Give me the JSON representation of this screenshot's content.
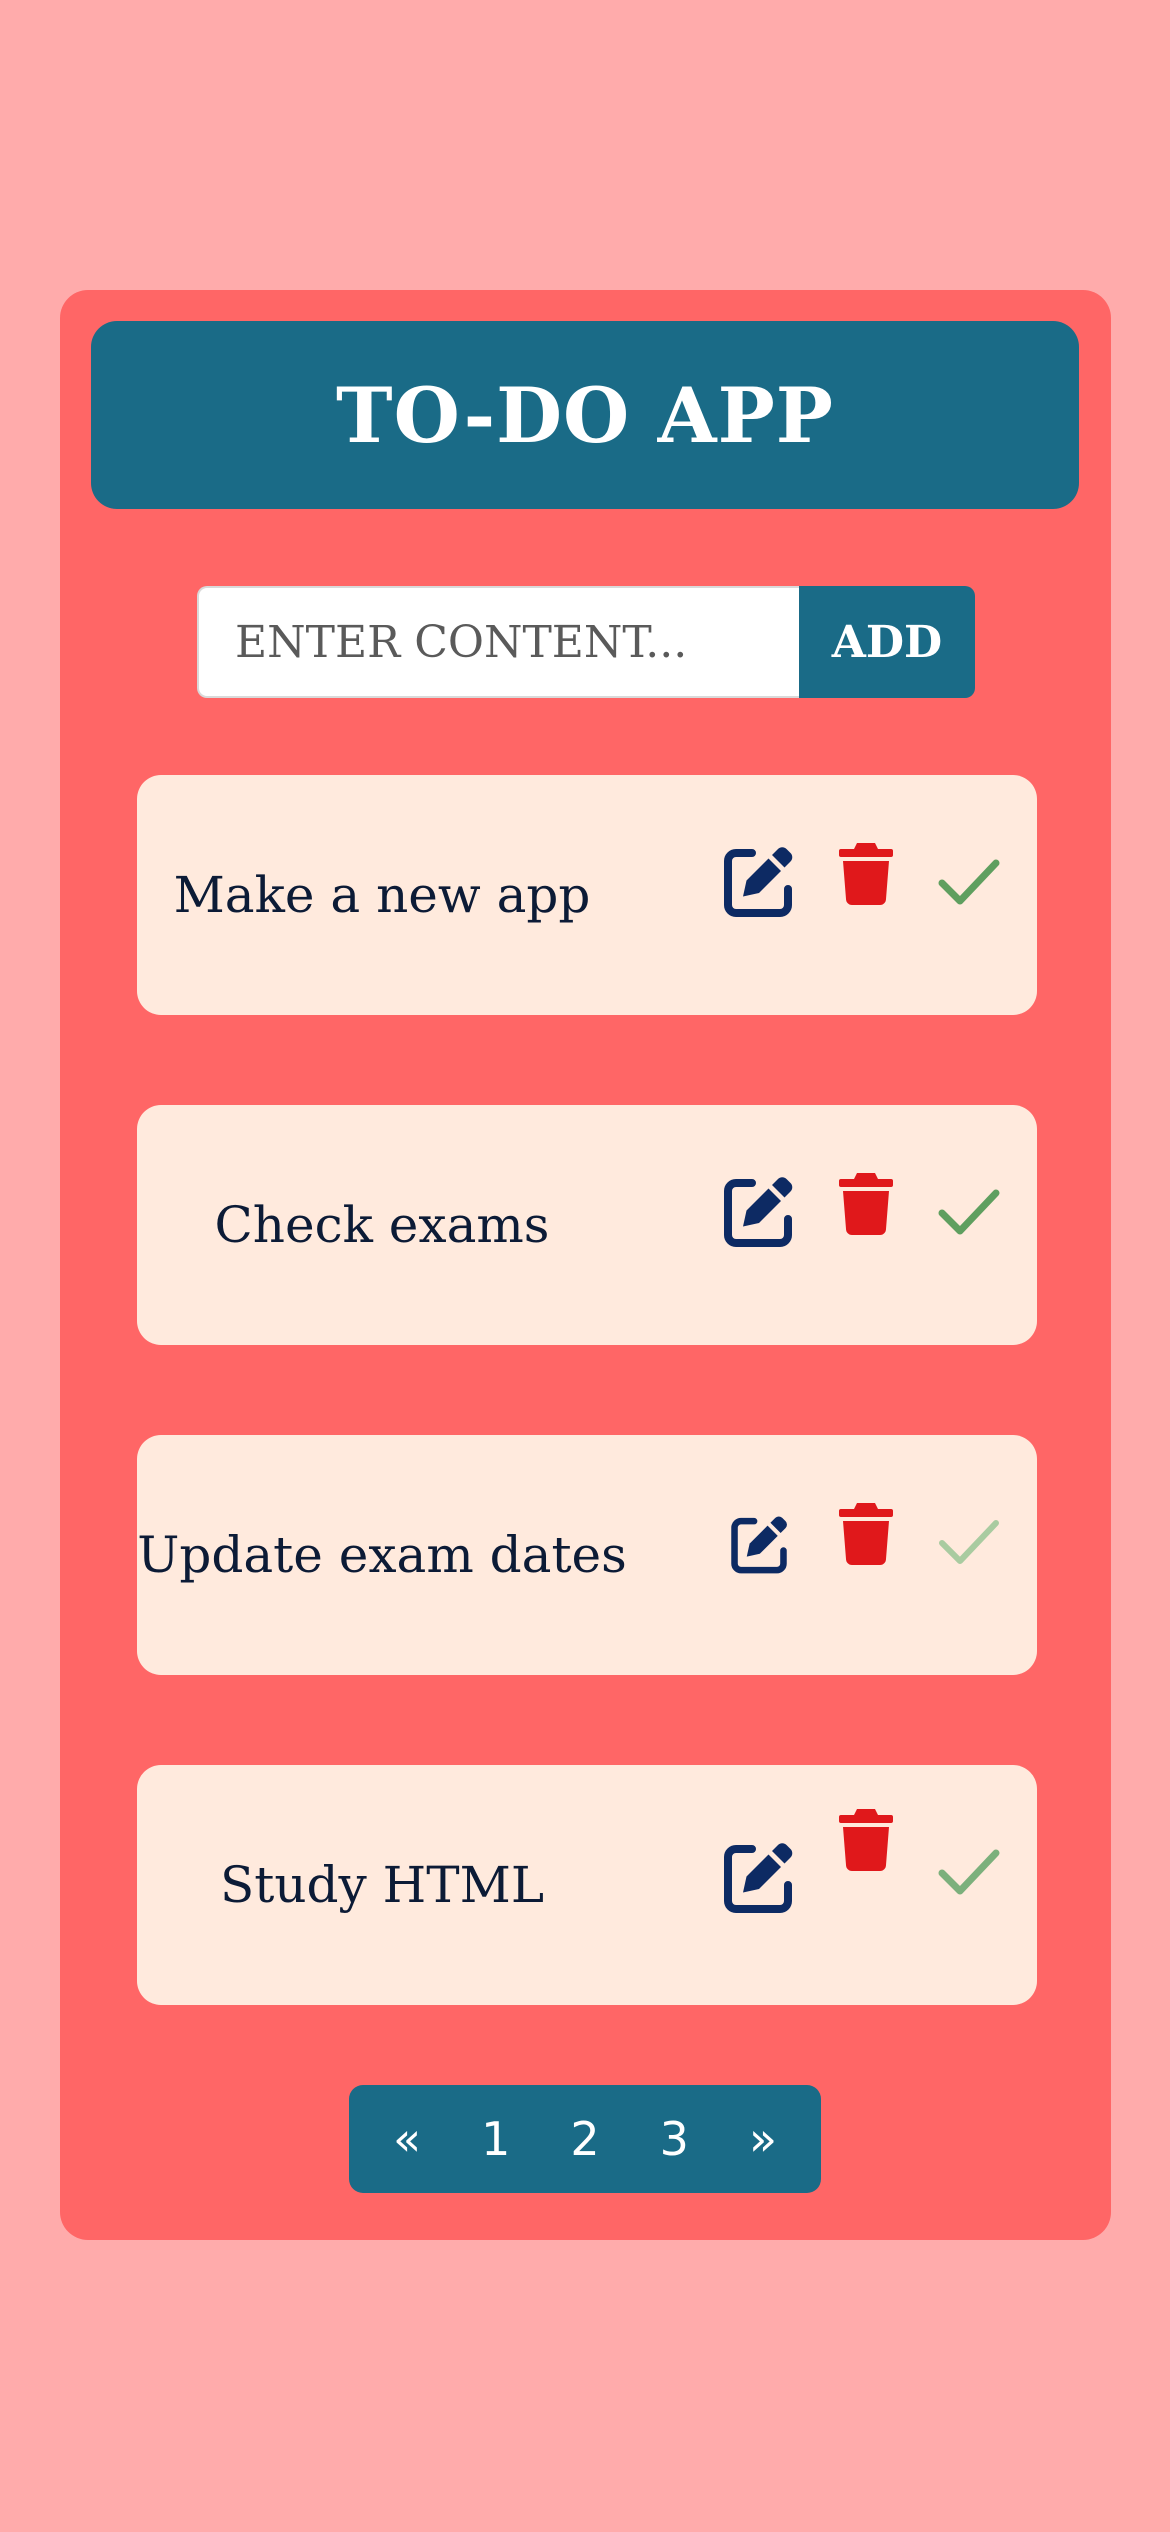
{
  "app": {
    "title": "TO-DO APP"
  },
  "input": {
    "placeholder": "ENTER CONTENT...",
    "value": "",
    "add_label": "ADD"
  },
  "todos": [
    {
      "text": "Make a new app",
      "completed": false
    },
    {
      "text": "Check exams",
      "completed": false
    },
    {
      "text": "Update exam dates",
      "completed": true
    },
    {
      "text": "Study HTML",
      "completed": false
    }
  ],
  "icons": {
    "edit": "pen-to-square-icon",
    "delete": "trash-icon",
    "complete": "check-icon"
  },
  "pagination": {
    "prev": "«",
    "pages": [
      "1",
      "2",
      "3"
    ],
    "next": "»"
  },
  "colors": {
    "page_bg": "#ffabab",
    "card_bg": "#ff6666",
    "header_bg": "#1a6b87",
    "item_bg": "#ffeadd",
    "text": "#0c1b36",
    "edit_icon": "#0d2a63",
    "delete_icon": "#e0181b",
    "check_icon": "#5f9f5f",
    "check_icon_done": "#a9cba0"
  }
}
